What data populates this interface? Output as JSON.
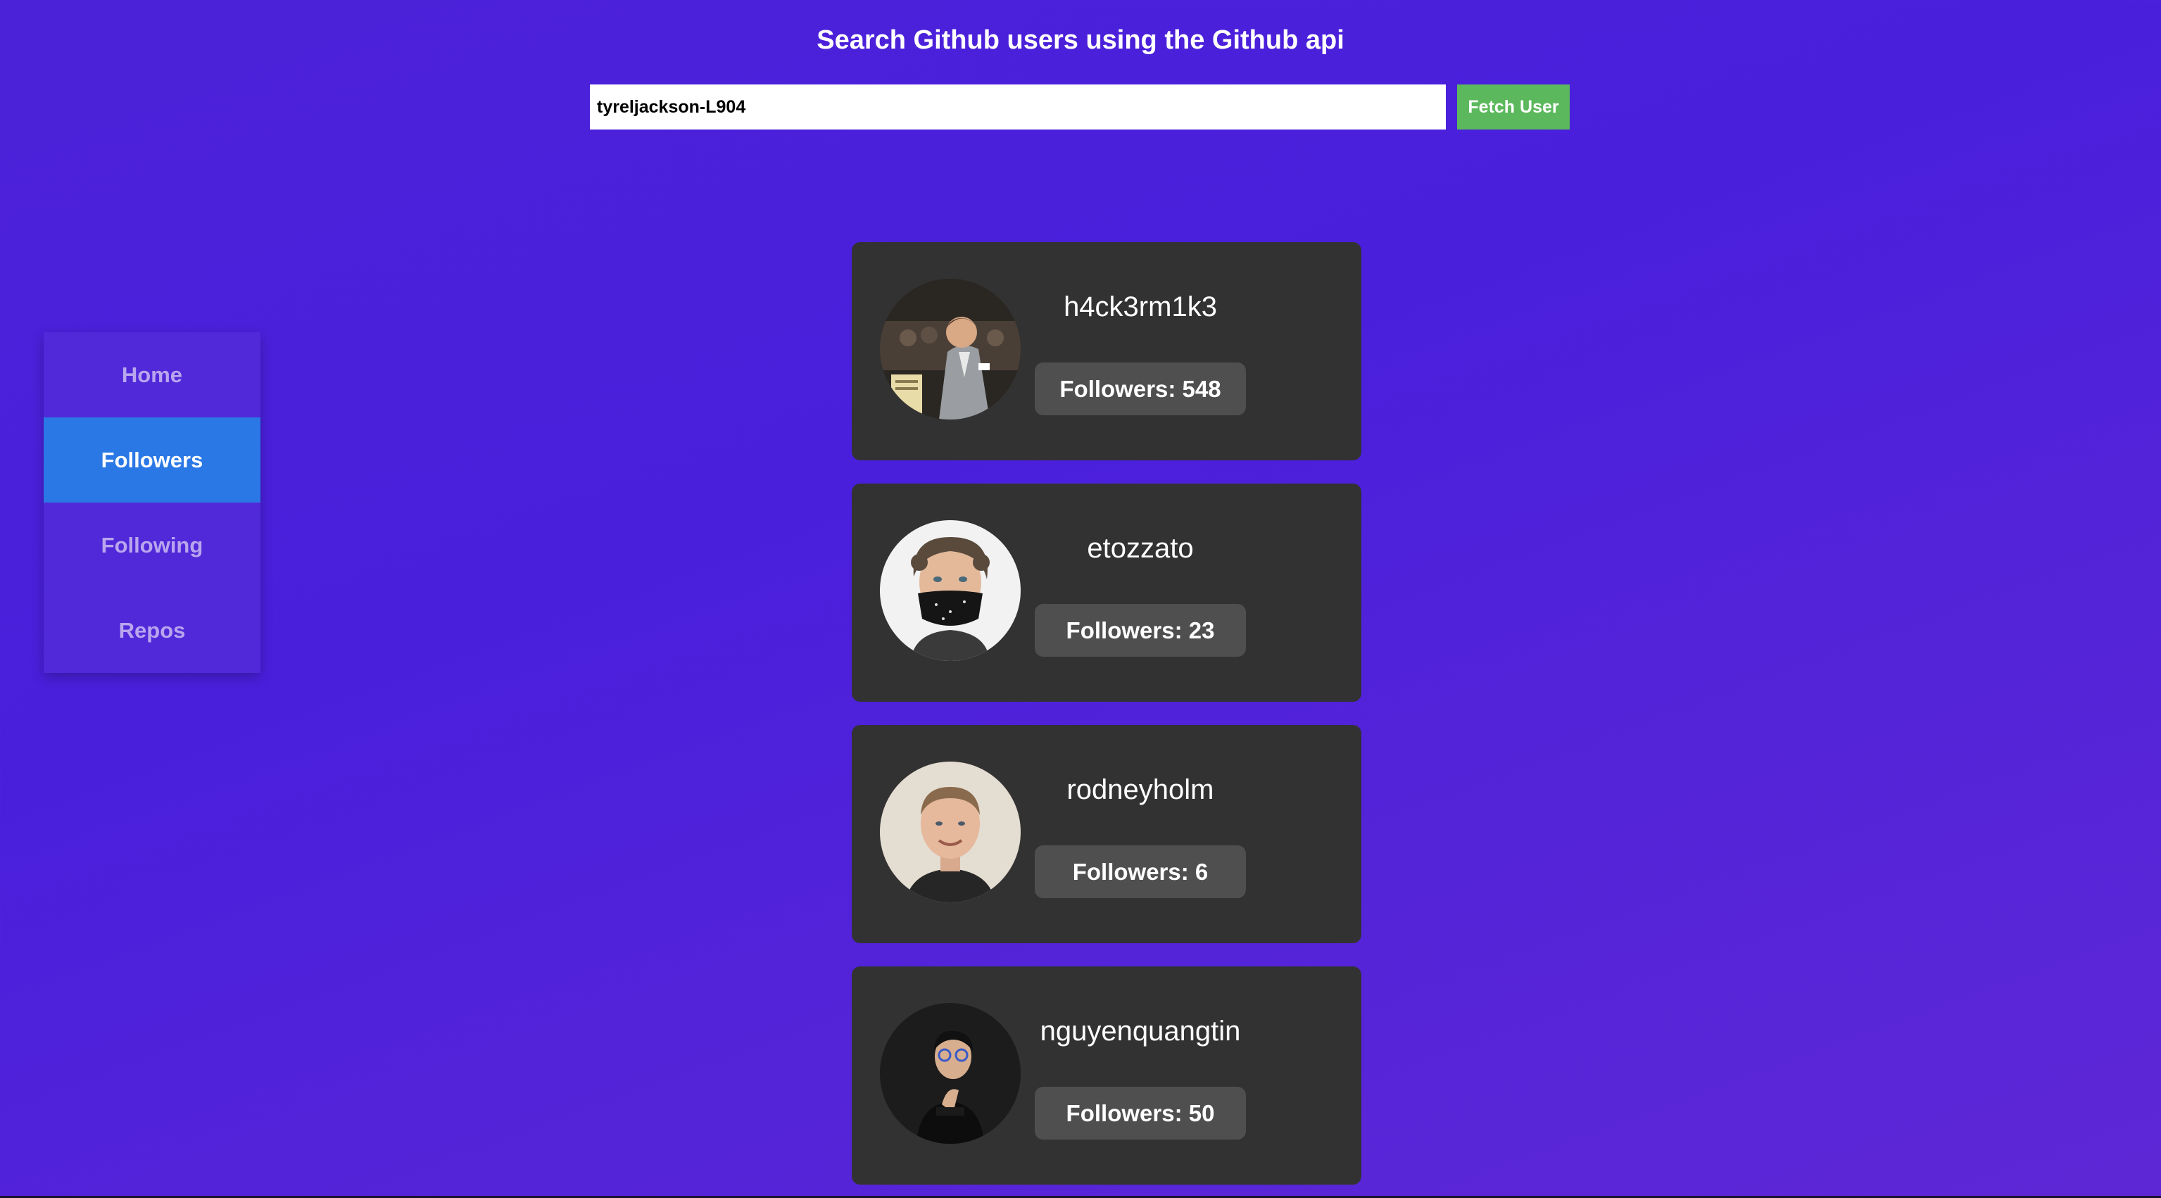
{
  "header": {
    "title": "Search Github users using the Github api"
  },
  "search": {
    "value": "tyreljackson-L904",
    "button_label": "Fetch User"
  },
  "sidebar": {
    "items": [
      {
        "label": "Home",
        "active": false
      },
      {
        "label": "Followers",
        "active": true
      },
      {
        "label": "Following",
        "active": false
      },
      {
        "label": "Repos",
        "active": false
      }
    ]
  },
  "followers": [
    {
      "username": "h4ck3rm1k3",
      "followers": "Followers: 548"
    },
    {
      "username": "etozzato",
      "followers": "Followers: 23"
    },
    {
      "username": "rodneyholm",
      "followers": "Followers: 6"
    },
    {
      "username": "nguyenquangtin",
      "followers": "Followers: 50"
    }
  ]
}
